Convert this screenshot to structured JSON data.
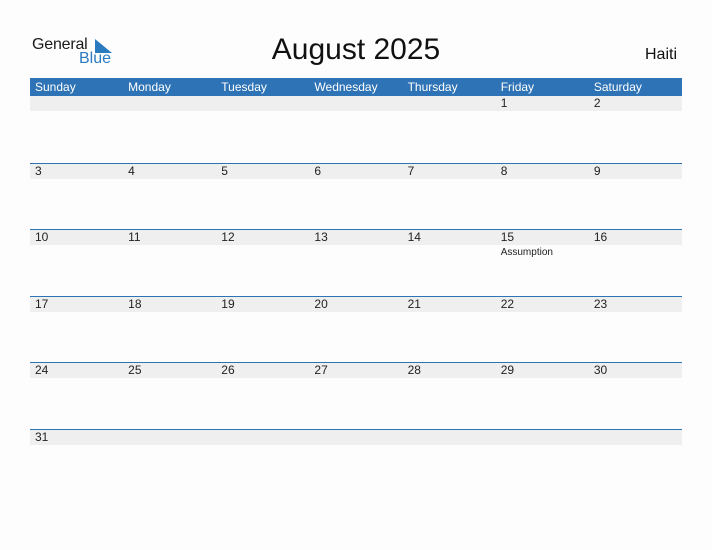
{
  "logo": {
    "line1": "General",
    "line2": "Blue"
  },
  "title": "August 2025",
  "country": "Haiti",
  "colors": {
    "accent": "#2e73b5",
    "date_strip": "#efefef",
    "logo_blue": "#2a7ac0"
  },
  "weekdays": [
    "Sunday",
    "Monday",
    "Tuesday",
    "Wednesday",
    "Thursday",
    "Friday",
    "Saturday"
  ],
  "weeks": [
    {
      "days": [
        "",
        "",
        "",
        "",
        "",
        "1",
        "2"
      ],
      "events": [
        "",
        "",
        "",
        "",
        "",
        "",
        ""
      ]
    },
    {
      "days": [
        "3",
        "4",
        "5",
        "6",
        "7",
        "8",
        "9"
      ],
      "events": [
        "",
        "",
        "",
        "",
        "",
        "",
        ""
      ]
    },
    {
      "days": [
        "10",
        "11",
        "12",
        "13",
        "14",
        "15",
        "16"
      ],
      "events": [
        "",
        "",
        "",
        "",
        "",
        "Assumption",
        ""
      ]
    },
    {
      "days": [
        "17",
        "18",
        "19",
        "20",
        "21",
        "22",
        "23"
      ],
      "events": [
        "",
        "",
        "",
        "",
        "",
        "",
        ""
      ]
    },
    {
      "days": [
        "24",
        "25",
        "26",
        "27",
        "28",
        "29",
        "30"
      ],
      "events": [
        "",
        "",
        "",
        "",
        "",
        "",
        ""
      ]
    },
    {
      "days": [
        "31",
        "",
        "",
        "",
        "",
        "",
        ""
      ],
      "events": [
        "",
        "",
        "",
        "",
        "",
        "",
        ""
      ]
    }
  ]
}
